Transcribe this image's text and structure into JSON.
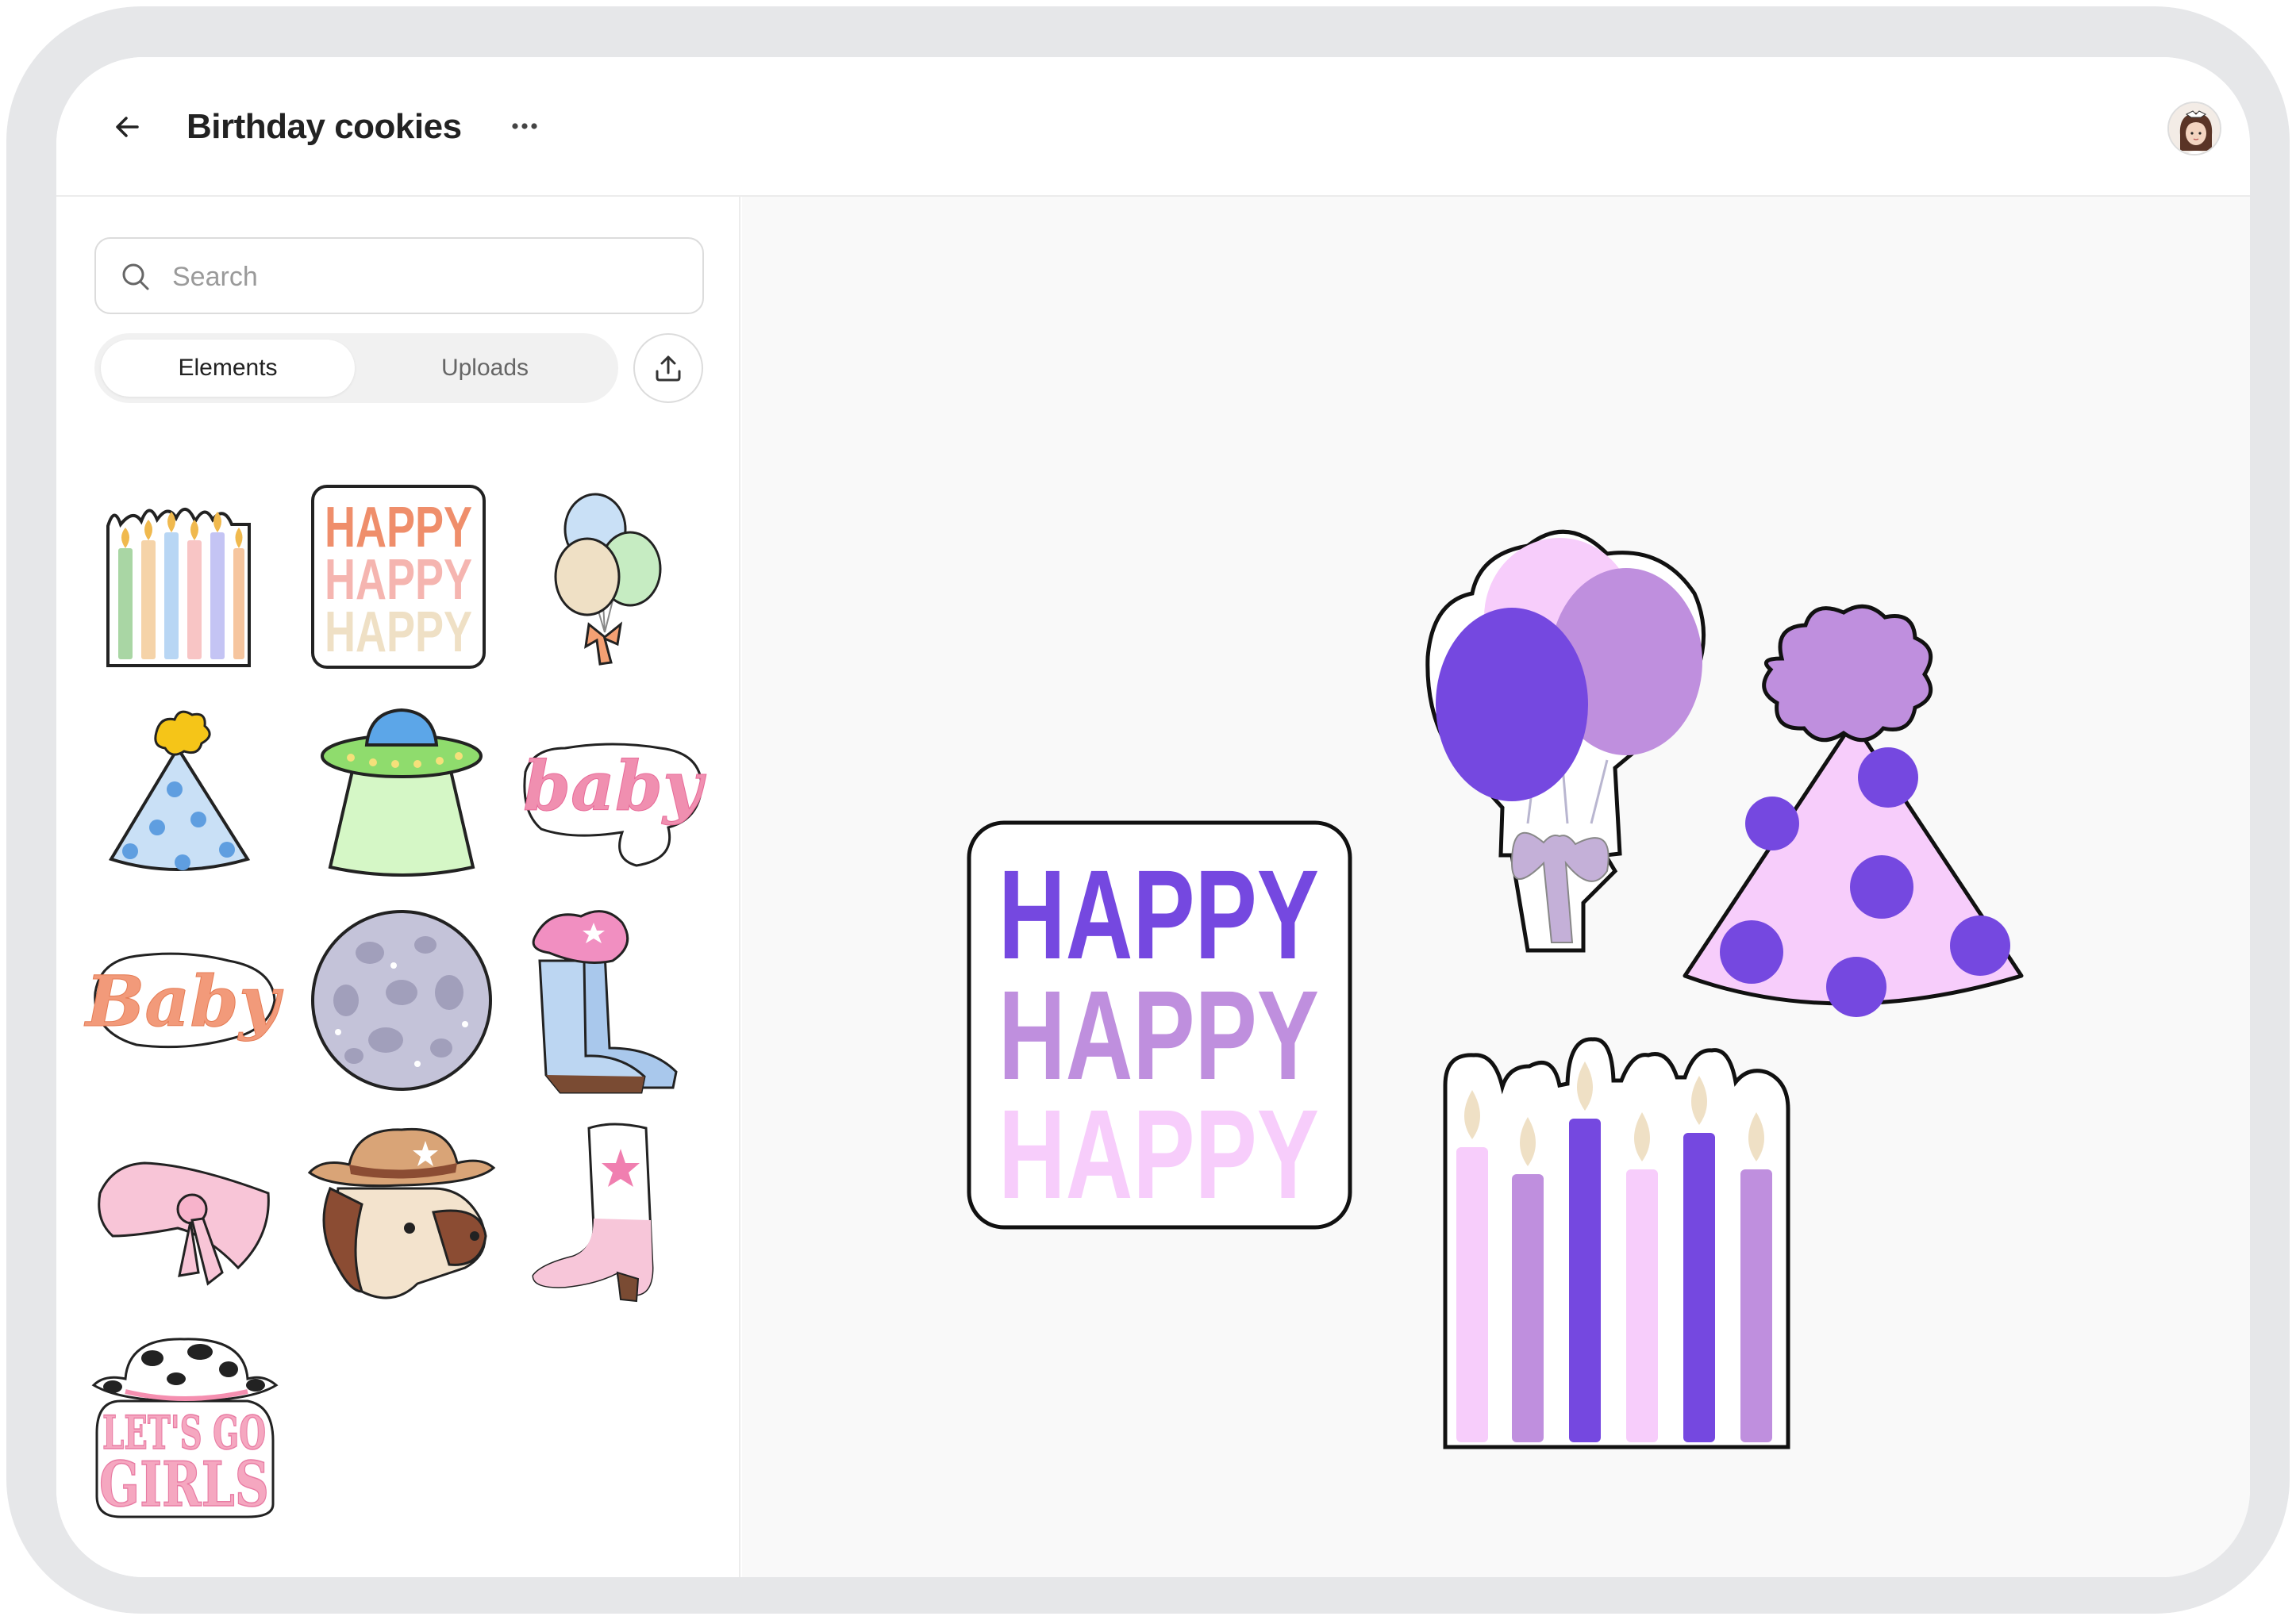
{
  "header": {
    "title": "Birthday cookies",
    "back_icon": "arrow-left-icon",
    "more_icon": "more-horizontal-icon",
    "avatar_icon": "user-avatar"
  },
  "sidebar": {
    "search": {
      "placeholder": "Search",
      "value": ""
    },
    "tabs": [
      {
        "label": "Elements",
        "active": true
      },
      {
        "label": "Uploads",
        "active": false
      }
    ],
    "upload_icon": "upload-icon",
    "elements": [
      {
        "name": "candles-element"
      },
      {
        "name": "happy-text-element",
        "lines": [
          "HAPPY",
          "HAPPY",
          "HAPPY"
        ]
      },
      {
        "name": "balloons-element"
      },
      {
        "name": "party-hat-element"
      },
      {
        "name": "ufo-element"
      },
      {
        "name": "baby-script-pink-element",
        "text": "baby"
      },
      {
        "name": "baby-script-orange-element",
        "text": "Baby"
      },
      {
        "name": "moon-element"
      },
      {
        "name": "cowboy-boots-element"
      },
      {
        "name": "bandana-element"
      },
      {
        "name": "horse-cowboy-hat-element"
      },
      {
        "name": "pink-boot-element"
      },
      {
        "name": "lets-go-girls-element",
        "lines": [
          "LET'S GO",
          "GIRLS"
        ]
      }
    ]
  },
  "canvas": {
    "items": [
      {
        "name": "canvas-happy-text",
        "lines": [
          "HAPPY",
          "HAPPY",
          "HAPPY"
        ]
      },
      {
        "name": "canvas-balloons"
      },
      {
        "name": "canvas-party-hat"
      },
      {
        "name": "canvas-candles"
      }
    ]
  },
  "colors": {
    "purple_dark": "#7548e0",
    "purple_mid": "#bf8fde",
    "purple_light": "#f7cdfb",
    "cream": "#efe0c5",
    "text_dark": "#222222"
  }
}
